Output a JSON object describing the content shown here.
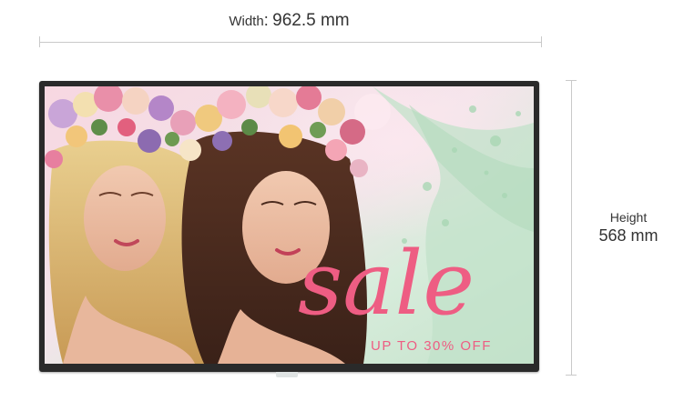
{
  "dimensions": {
    "width_label": "Width",
    "width_separator": ":",
    "width_value": "962.5 mm",
    "height_label": "Height",
    "height_value": "568 mm"
  },
  "screen_content": {
    "headline": "sale",
    "subline": "UP TO 30% OFF"
  },
  "colors": {
    "sale_pink": "#ee5d83",
    "background_mint": "#cfe6d3",
    "background_pink": "#f6dbe3",
    "bezel": "#2a2a2a"
  }
}
